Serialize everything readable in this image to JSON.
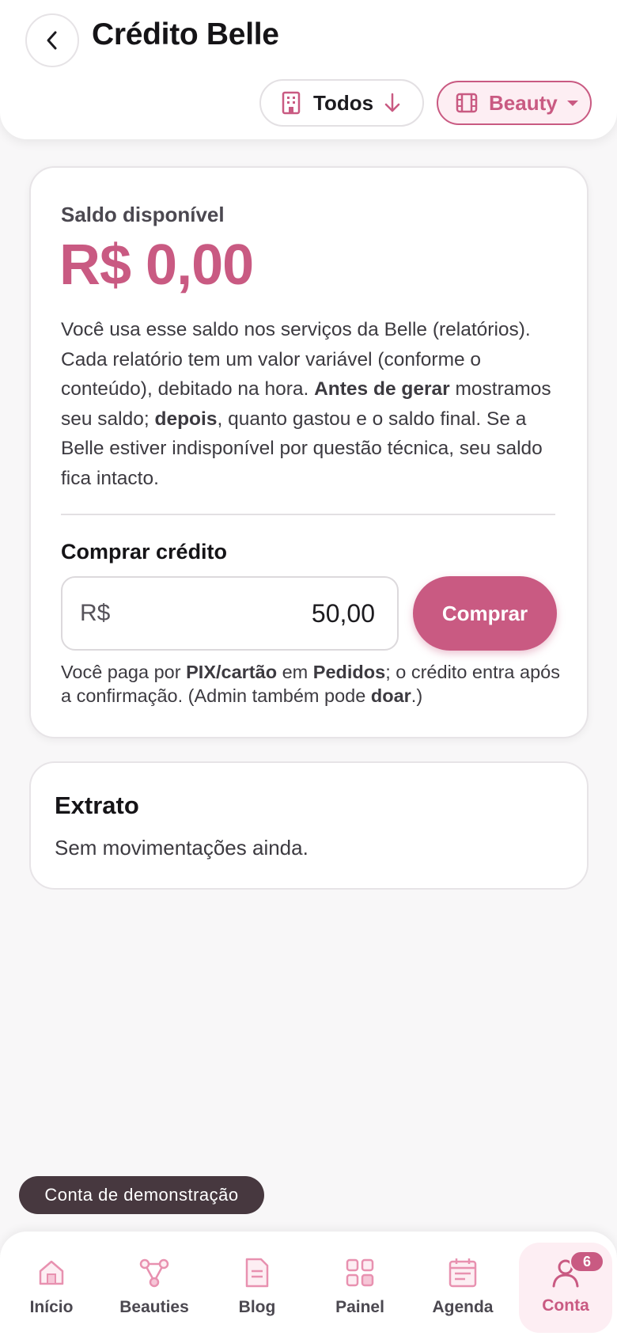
{
  "header": {
    "title": "Crédito Belle",
    "filter_todos_label": "Todos",
    "filter_beauty_label": "Beauty"
  },
  "balance": {
    "label": "Saldo disponível",
    "value": "R$ 0,00",
    "desc_part1": "Você usa esse saldo nos serviços da Belle (relatórios). Cada relatório tem um valor variável (conforme o conteúdo), debitado na hora. ",
    "desc_bold1": "Antes de gerar",
    "desc_part2": " mostramos seu saldo; ",
    "desc_bold2": "depois",
    "desc_part3": ", quanto gastou e o saldo final. Se a Belle estiver indisponível por questão técnica, seu saldo fica intacto."
  },
  "buy": {
    "title": "Comprar crédito",
    "currency_prefix": "R$",
    "amount_value": "50,00",
    "button_label": "Comprar",
    "note_part1": "Você paga por ",
    "note_bold1": "PIX/cartão",
    "note_part2": " em ",
    "note_bold2": "Pedidos",
    "note_part3": "; o crédito entra após a confirmação. (Admin também pode ",
    "note_bold3": "doar",
    "note_part4": ".)"
  },
  "statement": {
    "title": "Extrato",
    "empty_text": "Sem movimentações ainda."
  },
  "demo_badge": "Conta de demonstração",
  "nav": {
    "items": [
      {
        "label": "Início",
        "icon": "home-icon"
      },
      {
        "label": "Beauties",
        "icon": "network-icon"
      },
      {
        "label": "Blog",
        "icon": "document-icon"
      },
      {
        "label": "Painel",
        "icon": "grid-icon"
      },
      {
        "label": "Agenda",
        "icon": "calendar-icon"
      },
      {
        "label": "Conta",
        "icon": "user-icon",
        "badge": "6",
        "active": true
      }
    ]
  },
  "colors": {
    "accent": "#c95a82",
    "accent_light": "#fdeef3",
    "background": "#f8f7f8",
    "demo_badge_bg": "#47383f"
  }
}
